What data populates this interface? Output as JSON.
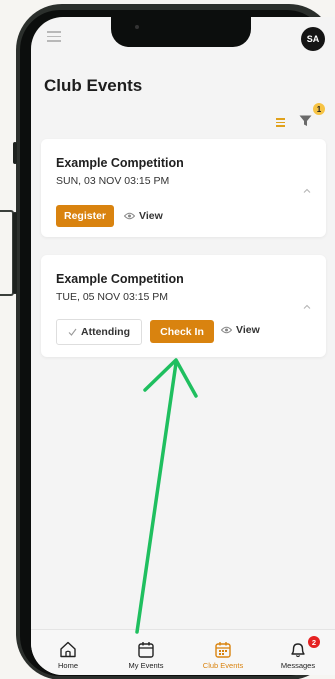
{
  "header": {
    "avatar_initials": "SA"
  },
  "page": {
    "title": "Club Events"
  },
  "filter": {
    "badge_count": "1"
  },
  "events": [
    {
      "title": "Example Competition",
      "date": "SUN, 03 NOV 03:15 PM",
      "register_label": "Register",
      "view_label": "View"
    },
    {
      "title": "Example Competition",
      "date": "TUE, 05 NOV 03:15 PM",
      "attending_label": "Attending",
      "checkin_label": "Check In",
      "view_label": "View"
    }
  ],
  "tabbar": {
    "tabs": [
      {
        "label": "Home",
        "icon": "home-icon"
      },
      {
        "label": "My Events",
        "icon": "calendar-icon"
      },
      {
        "label": "Club Events",
        "icon": "calendar-grid-icon",
        "active": true
      },
      {
        "label": "Messages",
        "icon": "bell-icon"
      }
    ],
    "messages_badge": "2"
  },
  "colors": {
    "accent": "#d9830f",
    "badge_red": "#e52222",
    "badge_yellow": "#f6c344",
    "annotation_arrow": "#1fbf5f"
  }
}
